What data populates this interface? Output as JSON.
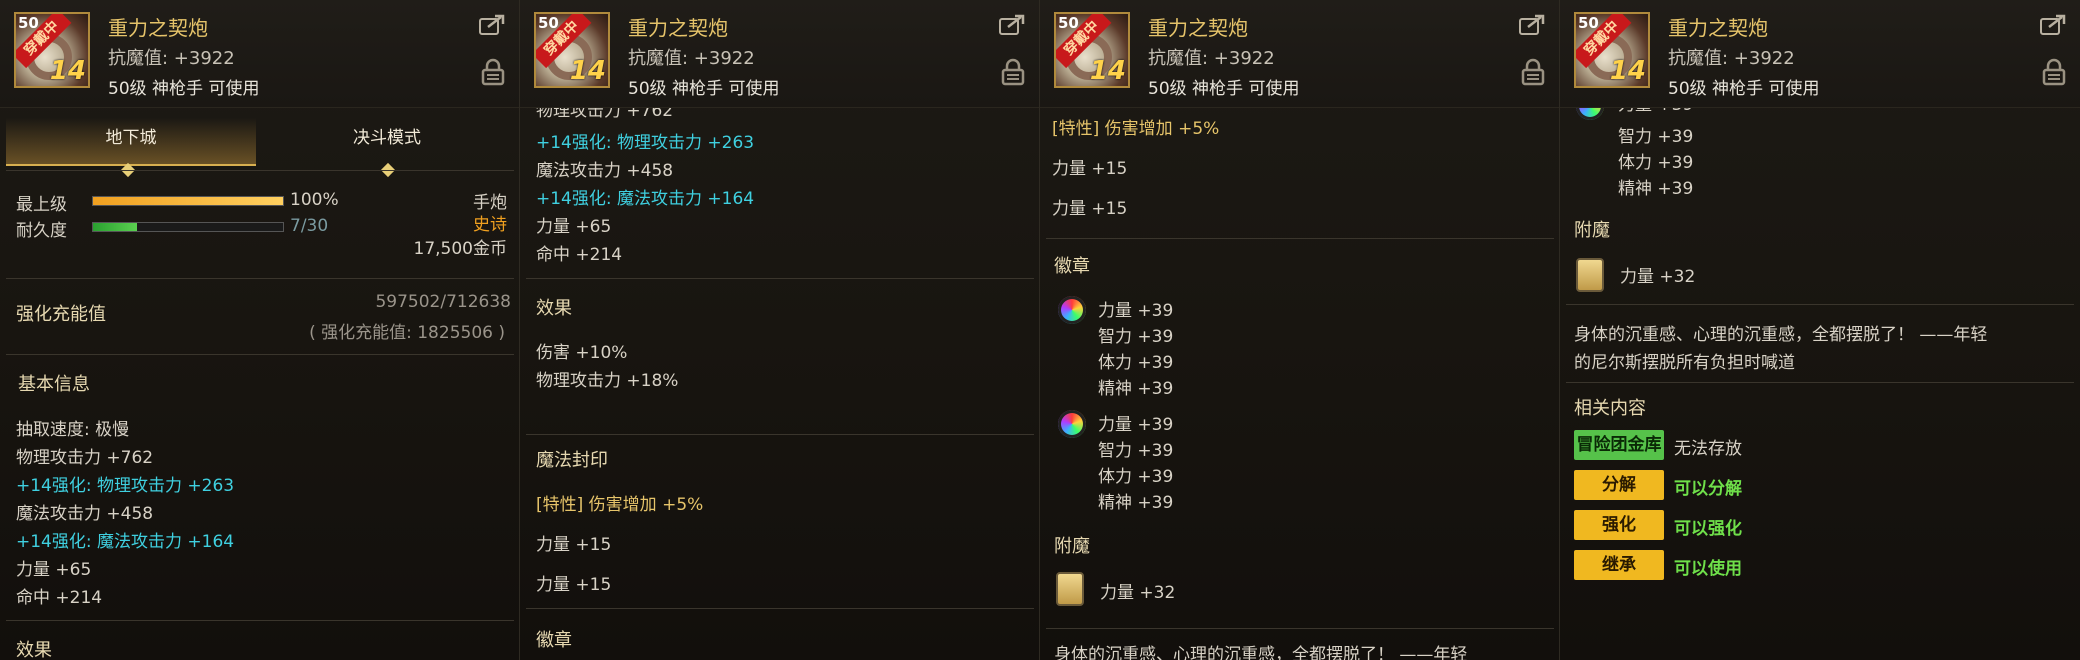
{
  "item": {
    "name": "重力之契炮",
    "stat": "抗魔值: +3922",
    "requirement": "50级 神枪手 可使用",
    "icon": {
      "level_badge": "50",
      "ribbon": "穿戴中",
      "enhance": "14"
    }
  },
  "tabs": [
    "地下城",
    "决斗模式"
  ],
  "summary": {
    "grade_label": "最上级",
    "grade_value": "100%",
    "durability_label": "耐久度",
    "durability_value": "7/30",
    "durability_fraction": 0.233,
    "grade_fraction": 1.0,
    "type": "手炮",
    "rarity": "史诗",
    "price": "17,500金币"
  },
  "charge": {
    "label": "强化充能值",
    "value": "597502/712638",
    "sub": "( 强化充能值: 1825506 )"
  },
  "basic": {
    "title": "基本信息",
    "lines": [
      "抽取速度: 极慢",
      "物理攻击力 +762",
      "+14强化: 物理攻击力 +263",
      "魔法攻击力 +458",
      "+14强化: 魔法攻击力 +164",
      "力量 +65",
      "命中 +214"
    ],
    "partial_top": "物理攻击力 +762"
  },
  "effect": {
    "title": "效果",
    "lines": [
      "伤害 +10%",
      "物理攻击力 +18%"
    ],
    "cut_title": "效果"
  },
  "seal": {
    "title": "魔法封印",
    "trait": "[特性] 伤害增加 +5%",
    "lines": [
      "力量 +15",
      "力量 +15"
    ]
  },
  "emblem": {
    "title": "徽章",
    "group1": [
      "力量 +39",
      "智力 +39",
      "体力 +39",
      "精神 +39"
    ],
    "group2": [
      "力量 +39",
      "智力 +39",
      "体力 +39",
      "精神 +39"
    ],
    "partial_top": "力量 +39"
  },
  "enchant": {
    "title": "附魔",
    "line": "力量 +32"
  },
  "flavor": {
    "line1": "身体的沉重感、心理的沉重感，全都摆脱了！ ——年轻",
    "line2": "的尼尔斯摆脱所有负担时喊道",
    "cut": "身体的沉重感、心理的沉重感，全都摆脱了！ ——年轻"
  },
  "related": {
    "title": "相关内容",
    "rows": [
      {
        "tag": "冒险团金库",
        "status": "无法存放"
      },
      {
        "tag": "分解",
        "status": "可以分解"
      },
      {
        "tag": "强化",
        "status": "可以强化"
      },
      {
        "tag": "继承",
        "status": "可以使用"
      }
    ]
  },
  "colors": {
    "gold": "#e6c46a",
    "cyan": "#3fd0e0",
    "button": "#f0b820",
    "green_button": "#56c24a",
    "ok_text": "#6fe04a"
  }
}
